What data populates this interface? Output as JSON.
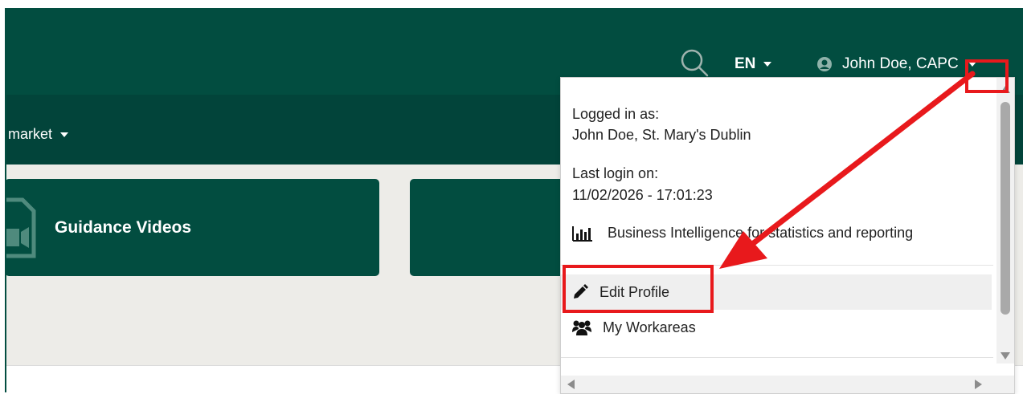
{
  "header": {
    "language": "EN",
    "user_name": "John Doe, CAPC",
    "nav_item": "market"
  },
  "tiles": [
    {
      "title": "Guidance Videos"
    }
  ],
  "user_menu": {
    "logged_in_label": "Logged in as:",
    "logged_in_value": "John Doe, St. Mary's Dublin",
    "last_login_label": "Last login on:",
    "last_login_value": "11/02/2026 - 17:01:23",
    "bi_link": "Business Intelligence for statistics and reporting",
    "edit_profile": "Edit Profile",
    "my_workareas": "My Workareas"
  },
  "colors": {
    "brand_green": "#024d40",
    "nav_green": "#02443a",
    "annotation_red": "#e8191c",
    "content_bg": "#edece8"
  },
  "icons": [
    "search-icon",
    "user-circle-icon",
    "bar-chart-icon",
    "pencil-icon",
    "users-icon",
    "video-document-icon"
  ]
}
